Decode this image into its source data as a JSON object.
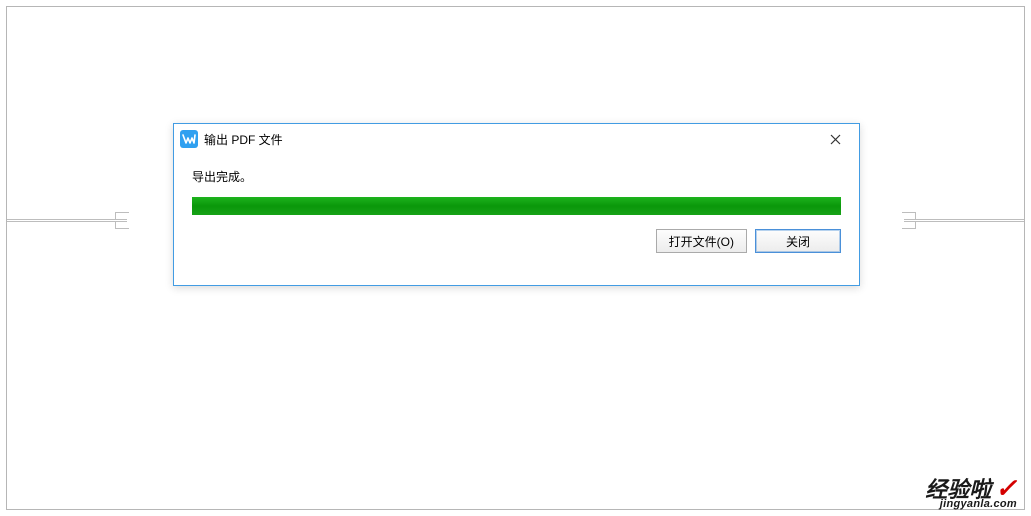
{
  "dialog": {
    "title": "输出 PDF 文件",
    "status_text": "导出完成。",
    "progress_percent": 100,
    "buttons": {
      "open_file": "打开文件(O)",
      "close": "关闭"
    }
  },
  "watermark": {
    "main": "经验啦",
    "check": "✓",
    "sub": "jingyanla.com"
  },
  "colors": {
    "dialog_border": "#429ce3",
    "progress_fill": "#1ea21e",
    "app_icon_bg": "#2fa0f0"
  }
}
